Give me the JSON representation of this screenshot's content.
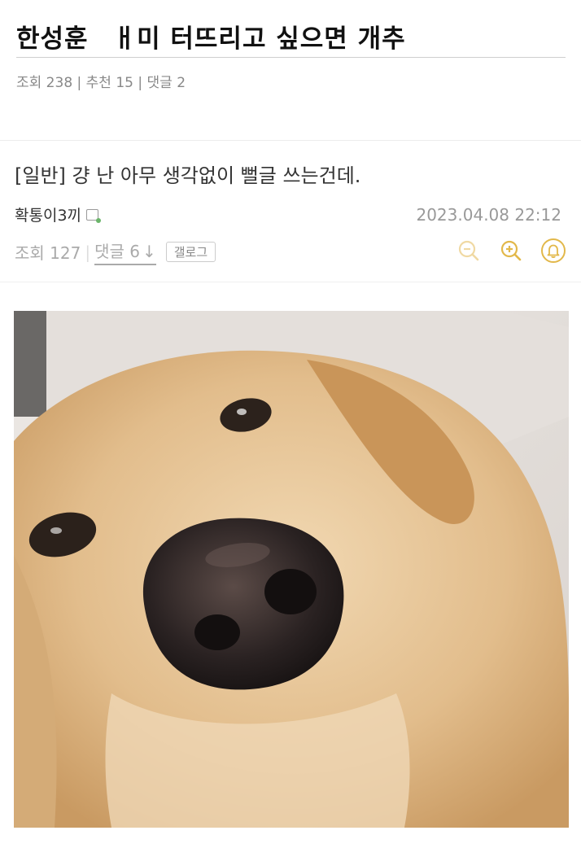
{
  "post": {
    "title_part1": "한성훈",
    "title_part2": "ㅐ미 터뜨리고 싶으면 개추",
    "stats": "조회 238 | 추천 15 | 댓글 2"
  },
  "article": {
    "title": "[일반] 걍 난 아무 생각없이 뻘글 쓰는건데.",
    "author": "확통이3끼",
    "date": "2023.04.08 22:12",
    "views": "조회 127",
    "comments": "댓글 6",
    "gallog": "갤로그",
    "icons": [
      "zoom-out-icon",
      "zoom-in-icon",
      "bell-icon"
    ]
  },
  "colors": {
    "icon_gold": "#e2b84a",
    "icon_gold_faded": "#f0d9a3"
  }
}
